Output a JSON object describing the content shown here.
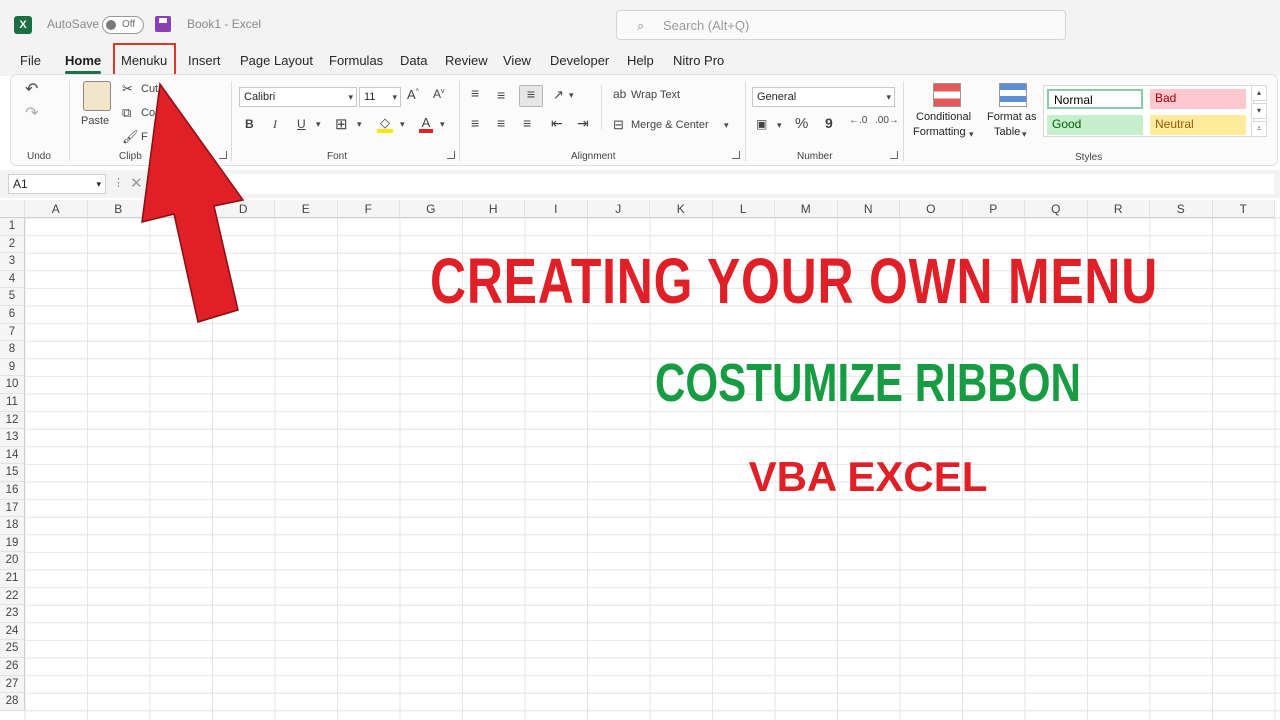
{
  "titlebar": {
    "autosave_label": "AutoSave",
    "autosave_state": "Off",
    "doc_title": "Book1  -  Excel",
    "search_placeholder": "Search (Alt+Q)"
  },
  "tabs": [
    {
      "label": "File"
    },
    {
      "label": "Home"
    },
    {
      "label": "Menuku"
    },
    {
      "label": "Insert"
    },
    {
      "label": "Page Layout"
    },
    {
      "label": "Formulas"
    },
    {
      "label": "Data"
    },
    {
      "label": "Review"
    },
    {
      "label": "View"
    },
    {
      "label": "Developer"
    },
    {
      "label": "Help"
    },
    {
      "label": "Nitro Pro"
    }
  ],
  "ribbon": {
    "undo_group": "Undo",
    "paste": "Paste",
    "cut": "Cut",
    "copy": "Co",
    "format_painter": "F",
    "clipboard_group": "Clipb",
    "font_name": "Calibri",
    "font_size": "11",
    "font_group": "Font",
    "bold": "B",
    "italic": "I",
    "underline": "U",
    "wrap_text": "Wrap Text",
    "merge_center": "Merge & Center",
    "alignment_group": "Alignment",
    "number_format": "General",
    "percent": "%",
    "comma": "9",
    "number_group": "Number",
    "conditional_formatting_1": "Conditional",
    "conditional_formatting_2": "Formatting",
    "format_as_table_1": "Format as",
    "format_as_table_2": "Table",
    "styles": {
      "normal": "Normal",
      "bad": "Bad",
      "good": "Good",
      "neutral": "Neutral"
    },
    "styles_group": "Styles"
  },
  "formula_bar": {
    "name_box": "A1"
  },
  "columns": [
    "A",
    "B",
    "C",
    "D",
    "E",
    "F",
    "G",
    "H",
    "I",
    "J",
    "K",
    "L",
    "M",
    "N",
    "O",
    "P",
    "Q",
    "R",
    "S",
    "T"
  ],
  "rows": [
    "1",
    "2",
    "3",
    "4",
    "5",
    "6",
    "7",
    "8",
    "9",
    "10",
    "11",
    "12",
    "13",
    "14",
    "15",
    "16",
    "17",
    "18",
    "19",
    "20",
    "21",
    "22",
    "23",
    "24",
    "25",
    "26",
    "27",
    "28"
  ],
  "overlay": {
    "headline": "CREATING YOUR OWN MENU",
    "subheadline": "COSTUMIZE RIBBON",
    "tagline": "VBA EXCEL"
  },
  "colors": {
    "excel_green": "#1d6f42",
    "arrow_red": "#e01f26",
    "headline_red": "#e01f26",
    "subheadline_green": "#179c43",
    "highlight_box": "#d93a2a"
  }
}
